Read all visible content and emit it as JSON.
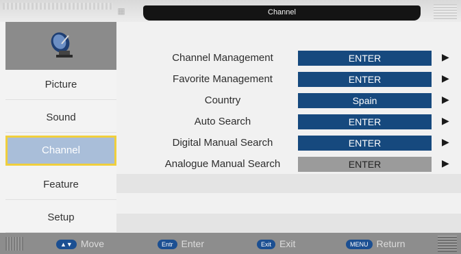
{
  "header": {
    "title": "Channel"
  },
  "sidebar": {
    "items": [
      {
        "label": "Picture"
      },
      {
        "label": "Sound"
      },
      {
        "label": "Channel"
      },
      {
        "label": "Feature"
      },
      {
        "label": "Setup"
      }
    ]
  },
  "menu": {
    "rows": [
      {
        "label": "Channel Management",
        "value": "ENTER"
      },
      {
        "label": "Favorite Management",
        "value": "ENTER"
      },
      {
        "label": "Country",
        "value": "Spain"
      },
      {
        "label": "Auto Search",
        "value": "ENTER"
      },
      {
        "label": "Digital Manual Search",
        "value": "ENTER"
      },
      {
        "label": "Analogue Manual Search",
        "value": "ENTER"
      }
    ]
  },
  "footer": {
    "move": {
      "key": "▲▼",
      "label": "Move"
    },
    "enter": {
      "key": "Entr",
      "label": "Enter"
    },
    "exit": {
      "key": "Exit",
      "label": "Exit"
    },
    "return": {
      "key": "MENU",
      "label": "Return"
    }
  },
  "colors": {
    "value_bg": "#16497e",
    "active_sidebar": "#a9bed9",
    "highlight_border": "#f0cf3c"
  }
}
